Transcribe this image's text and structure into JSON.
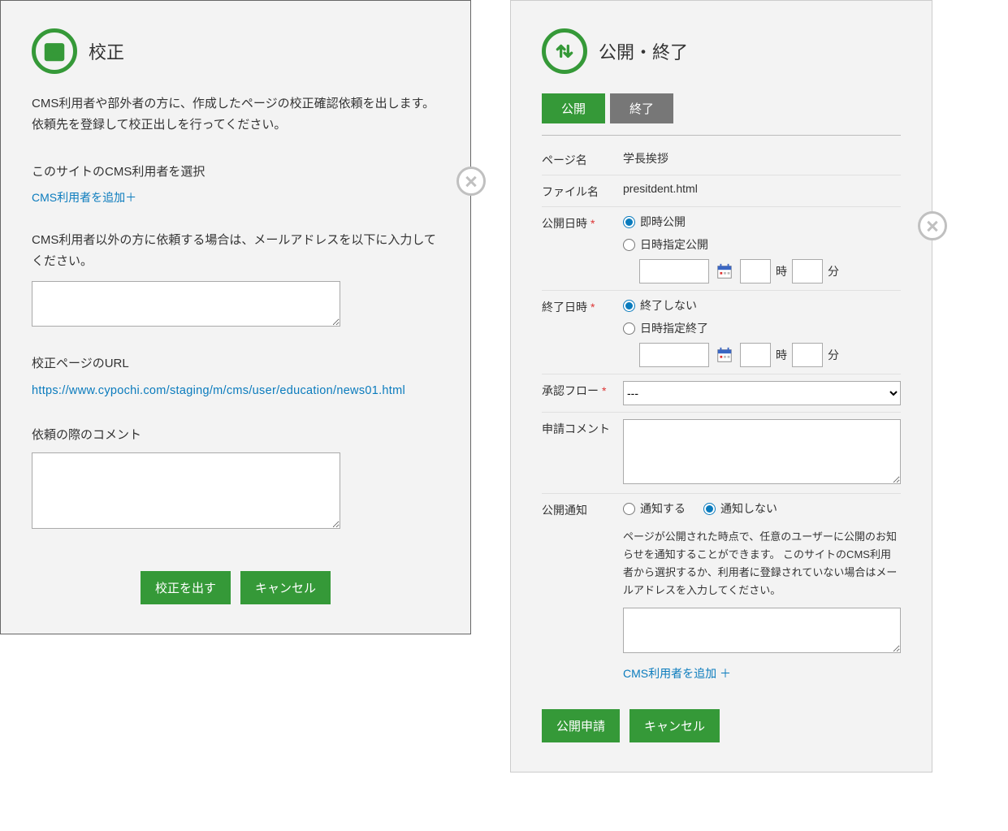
{
  "proof": {
    "title": "校正",
    "intro": "CMS利用者や部外者の方に、作成したページの校正確認依頼を出します。依頼先を登録して校正出しを行ってください。",
    "select_user_label": "このサイトのCMS利用者を選択",
    "add_user_link": "CMS利用者を追加＋",
    "external_email_label": "CMS利用者以外の方に依頼する場合は、メールアドレスを以下に入力してください。",
    "url_label": "校正ページのURL",
    "url_value": "https://www.cypochi.com/staging/m/cms/user/education/news01.html",
    "comment_label": "依頼の際のコメント",
    "submit_label": "校正を出す",
    "cancel_label": "キャンセル"
  },
  "publish": {
    "title": "公開・終了",
    "tab_publish": "公開",
    "tab_end": "終了",
    "page_name_label": "ページ名",
    "page_name_value": "学長挨拶",
    "file_name_label": "ファイル名",
    "file_name_value": "presitdent.html",
    "pub_date_label": "公開日時",
    "pub_radio_now": "即時公開",
    "pub_radio_scheduled": "日時指定公開",
    "end_date_label": "終了日時",
    "end_radio_none": "終了しない",
    "end_radio_scheduled": "日時指定終了",
    "hour_unit": "時",
    "min_unit": "分",
    "flow_label": "承認フロー",
    "flow_placeholder": "---",
    "app_comment_label": "申請コメント",
    "notify_label": "公開通知",
    "notify_yes": "通知する",
    "notify_no": "通知しない",
    "notify_note": "ページが公開された時点で、任意のユーザーに公開のお知らせを通知することができます。\nこのサイトのCMS利用者から選択するか、利用者に登録されていない場合はメールアドレスを入力してください。",
    "notify_add_user": "CMS利用者を追加 ＋",
    "submit_label": "公開申請",
    "cancel_label": "キャンセル"
  }
}
